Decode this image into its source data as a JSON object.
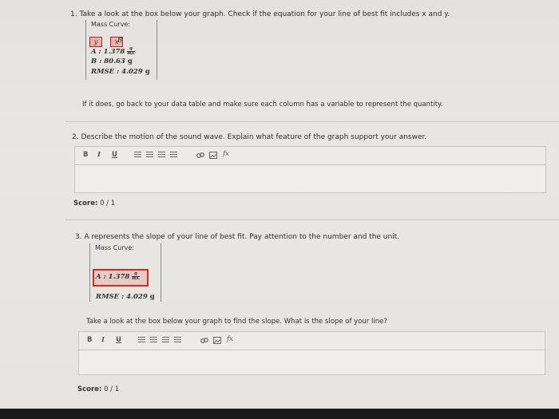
{
  "q1": {
    "text": "1. Take a look at the box below your graph. Check if the equation for your line of best fit includes x and y.",
    "mass_title": "Mass Curve:",
    "sym_y": "y",
    "sym_x": "x",
    "sym_b": "B",
    "a_line_label": "A : 1.378",
    "a_unit_num": "g",
    "a_unit_den": "mL",
    "b_line": "B : 80.63",
    "b_unit": "g",
    "rmse_line": "RMSE : 4.029",
    "rmse_unit": "g",
    "follow_up": "If it does, go back to your data table and make sure each column has a variable to represent the quantity."
  },
  "q2": {
    "text": "2. Describe the motion of the sound wave. Explain what feature of the graph support your answer.",
    "toolbar": {
      "bold": "B",
      "italic": "I",
      "underline": "U",
      "fx": "fx"
    },
    "score_label": "Score:",
    "score_value": "0 / 1"
  },
  "q3": {
    "text": "3. A represents the slope of your line of best fit. Pay attention to the number and the unit.",
    "mass_title": "Mass Curve:",
    "a_line_label": "A : 1.378",
    "a_unit_num": "g",
    "a_unit_den": "mL",
    "rmse_line": "RMSE : 4.029",
    "rmse_unit": "g",
    "prompt": "Take a look at the box below your graph to find the slope. What is the slope of your line?",
    "toolbar": {
      "bold": "B",
      "italic": "I",
      "underline": "U",
      "fx": "fx"
    },
    "score_label": "Score:",
    "score_value": "0 / 1"
  },
  "colors": {
    "highlight": "#d42c25",
    "background": "#e7e5e1",
    "editor": "#efeeeb"
  },
  "icons": [
    "bullet-list-icon",
    "numbered-list-icon",
    "outdent-icon",
    "indent-icon",
    "link-icon",
    "image-icon",
    "formula-icon"
  ]
}
